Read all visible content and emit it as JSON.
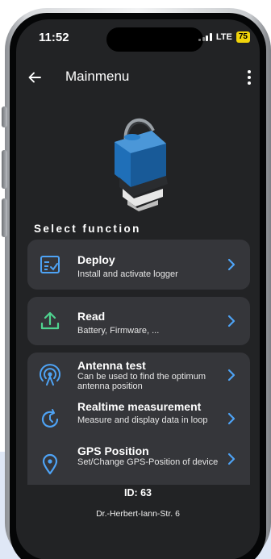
{
  "status": {
    "time": "11:52",
    "network": "LTE",
    "battery": "75"
  },
  "appbar": {
    "title": "Mainmenu"
  },
  "device": {
    "image_icon": "logger-device-image"
  },
  "section_title": "Select function",
  "menu": [
    {
      "id": "deploy",
      "icon": "clipboard-check-icon",
      "title": "Deploy",
      "subtitle": "Install and activate logger"
    },
    {
      "id": "read",
      "icon": "upload-icon",
      "title": "Read",
      "subtitle": "Battery, Firmware, ..."
    },
    {
      "id": "antenna",
      "icon": "antenna-icon",
      "title": "Antenna test",
      "subtitle": "Can be used to find the optimum antenna position"
    },
    {
      "id": "realtime",
      "icon": "timer-refresh-icon",
      "title": "Realtime measurement",
      "subtitle": "Measure and display data in loop"
    },
    {
      "id": "gps",
      "icon": "location-pin-icon",
      "title": "GPS Position",
      "subtitle": "Set/Change GPS-Position of device"
    }
  ],
  "footer": {
    "id": "ID: 63",
    "address": "Dr.-Herbert-Iann-Str. 6"
  },
  "colors": {
    "accent": "#4ea3f5",
    "icon_green": "#4fd38f",
    "card": "#35363a",
    "screen_bg": "#222325",
    "device_blue": "#1f6fb8",
    "battery": "#f1d40b"
  }
}
